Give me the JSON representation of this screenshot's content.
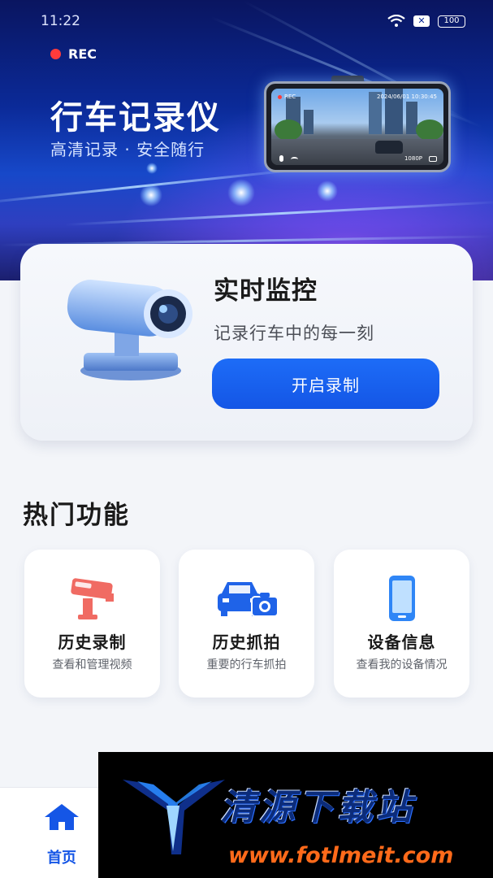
{
  "status_bar": {
    "time": "11:22",
    "battery": "100"
  },
  "hero": {
    "rec_label": "REC",
    "title": "行车记录仪",
    "subtitle": "高清记录 · 安全随行",
    "screen_rec": "REC",
    "screen_datetime": "2024/06/01 10:30:45",
    "screen_resolution": "1080P"
  },
  "monitor": {
    "title": "实时监控",
    "subtitle": "记录行车中的每一刻",
    "button_label": "开启录制"
  },
  "hot_section": {
    "title": "热门功能"
  },
  "features": [
    {
      "title": "历史录制",
      "desc": "查看和管理视频",
      "icon": "cctv-icon",
      "color": "#f06b63"
    },
    {
      "title": "历史抓拍",
      "desc": "重要的行车抓拍",
      "icon": "car-camera-icon",
      "color": "#1f63e8"
    },
    {
      "title": "设备信息",
      "desc": "查看我的设备情况",
      "icon": "phone-icon",
      "color": "#2f86f6"
    }
  ],
  "tab_bar": {
    "home_label": "首页",
    "accent": "#1556e6"
  },
  "watermark": {
    "name": "清源下载站",
    "url": "www.fotlmeit.com"
  }
}
